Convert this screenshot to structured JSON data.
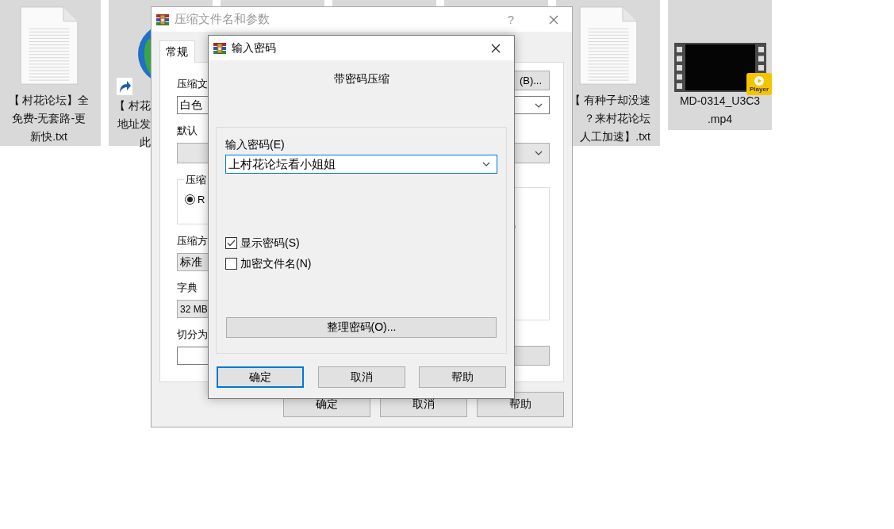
{
  "desktop": {
    "icons": [
      {
        "kind": "text-file",
        "selected": true,
        "label_lines": [
          "【 村花论坛】全",
          "免费-无套路-更",
          "新快.txt"
        ]
      },
      {
        "kind": "shortcut",
        "selected": true,
        "label_lines": [
          "【 村花",
          "地址发",
          "此"
        ]
      },
      {
        "kind": "covered",
        "selected": true
      },
      {
        "kind": "covered",
        "selected": true
      },
      {
        "kind": "covered",
        "selected": true
      },
      {
        "kind": "text-file",
        "selected": true,
        "label_lines": [
          "【 有种子却没速",
          "？来村花论坛",
          "人工加速】.txt"
        ]
      },
      {
        "kind": "video",
        "selected": true,
        "badge": "Player",
        "label_lines": [
          "MD-0314_U3C3",
          ".mp4"
        ]
      }
    ]
  },
  "back_window": {
    "title": "压缩文件名和参数",
    "help": "?",
    "tabs": [
      {
        "label": "常规",
        "selected": true
      }
    ],
    "archive_name_label": "压缩文",
    "browse_button": "(B)...",
    "archive_name_value": "白色",
    "profile_label": "默认",
    "format_group_label": "压缩",
    "format_options": [
      {
        "label": "R",
        "selected": true
      }
    ],
    "method_label": "压缩方",
    "method_value": "标准",
    "dictionary_label": "字典",
    "dictionary_value": "32 MB",
    "split_label": "切分为",
    "buttons": [
      "确定",
      "取消",
      "帮助"
    ]
  },
  "password_dialog": {
    "title": "输入密码",
    "heading": "带密码压缩",
    "password_label": "输入密码(E)",
    "password_value": "上村花论坛看小姐姐",
    "options": [
      {
        "label": "显示密码(S)",
        "checked": true
      },
      {
        "label": "加密文件名(N)",
        "checked": false
      }
    ],
    "organize_button": "整理密码(O)...",
    "buttons": [
      {
        "label": "确定",
        "default": true
      },
      {
        "label": "取消",
        "default": false
      },
      {
        "label": "帮助",
        "default": false
      }
    ]
  }
}
